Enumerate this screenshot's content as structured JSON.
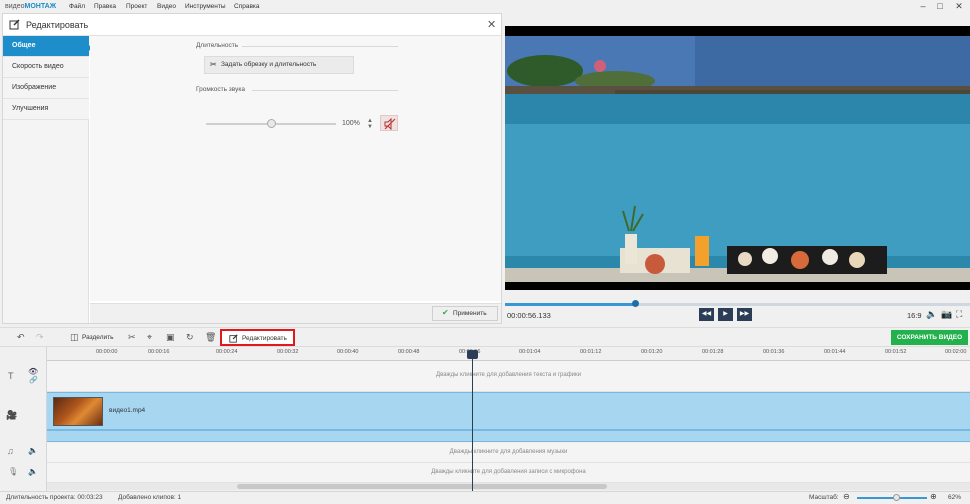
{
  "app": {
    "title_part1": "видео",
    "title_part2": "МОНТАЖ",
    "menu": [
      "Файл",
      "Правка",
      "Проект",
      "Видео",
      "Инструменты",
      "Справка"
    ]
  },
  "edit_panel": {
    "title": "Редактировать",
    "sidebar": [
      "Общее",
      "Скорость видео",
      "Изображение",
      "Улучшения"
    ],
    "duration_label": "Длительность",
    "trim_button": "Задать обрезку и длительность",
    "volume_label": "Громкость звука",
    "volume_value": "100%",
    "volume_level": 0.5,
    "apply_button": "Применить"
  },
  "player": {
    "current_time": "00:00:56.133",
    "aspect_ratio": "16:9",
    "progress": 0.28
  },
  "toolbar": {
    "split_label": "Разделить",
    "edit_label": "Редактировать",
    "save_label": "СОХРАНИТЬ ВИДЕО"
  },
  "timeline": {
    "ticks": [
      "00:00:00",
      "00:00:16",
      "00:00:24",
      "00:00:32",
      "00:00:40",
      "00:00:48",
      "00:00:56",
      "00:01:04",
      "00:01:12",
      "00:01:20",
      "00:01:28",
      "00:01:36",
      "00:01:44",
      "00:01:52",
      "00:02:00"
    ],
    "text_hint": "Дважды кликните для добавления текста и графики",
    "clip_name": "видео1.mp4",
    "music_hint": "Дважды кликните для добавления музыки",
    "mic_hint": "Дважды кликните для добавления записи с микрофона"
  },
  "status": {
    "duration": "Длительность проекта:  00:03:23",
    "clips": "Добавлено клипов: 1",
    "zoom_label": "Масштаб:",
    "zoom_value": "62%"
  },
  "colors": {
    "accent": "#1e8ecb",
    "save": "#22b14c",
    "highlight": "#e0191d"
  }
}
